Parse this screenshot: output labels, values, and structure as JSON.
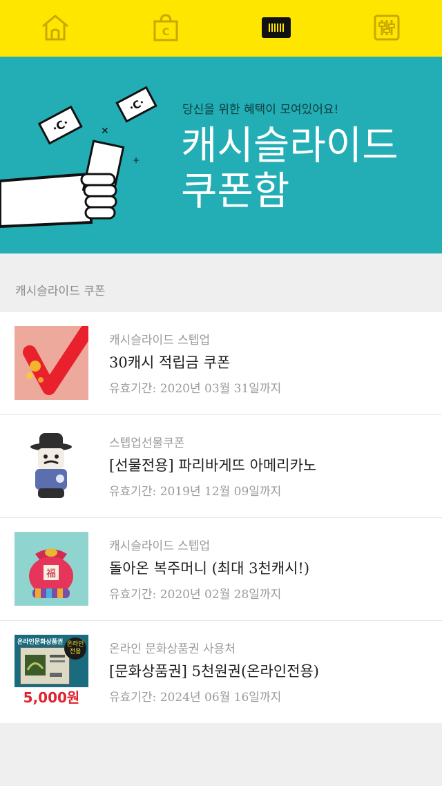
{
  "nav": {
    "items": [
      {
        "name": "home-icon"
      },
      {
        "name": "shopping-bag-icon"
      },
      {
        "name": "coupon-box-icon"
      },
      {
        "name": "settings-sliders-icon"
      }
    ],
    "active_index": 2,
    "accent_color": "#ffe600"
  },
  "banner": {
    "subtitle": "당신을 위한 혜택이 모여있어요!",
    "title_line1": "캐시슬라이드",
    "title_line2": "쿠폰함",
    "background_color": "#22aeb4"
  },
  "section": {
    "label": "캐시슬라이드 쿠폰"
  },
  "coupons": [
    {
      "category": "캐시슬라이드 스텝업",
      "name": "30캐시 적립금 쿠폰",
      "expiry": "유효기간: 2020년 03월 31일까지",
      "thumb_icon": "red-v-checkmark-image"
    },
    {
      "category": "스텝업선물쿠폰",
      "name": "[선물전용] 파리바게뜨 아메리카노",
      "expiry": "유효기간: 2019년 12월 09일까지",
      "thumb_icon": "coffee-cup-character-image"
    },
    {
      "category": "캐시슬라이드 스텝업",
      "name": "돌아온 복주머니 (최대 3천캐시!)",
      "expiry": "유효기간: 2020년 02월 28일까지",
      "thumb_icon": "lucky-pouch-image"
    },
    {
      "category": "온라인 문화상품권 사용처",
      "name": "[문화상품권] 5천원권(온라인전용)",
      "expiry": "유효기간: 2024년 06월 16일까지",
      "thumb_icon": "gift-card-image",
      "thumb_text": {
        "top": "온라인문화상품권",
        "badge_line1": "온라인",
        "badge_line2": "전용",
        "price": "5,000원"
      }
    }
  ]
}
